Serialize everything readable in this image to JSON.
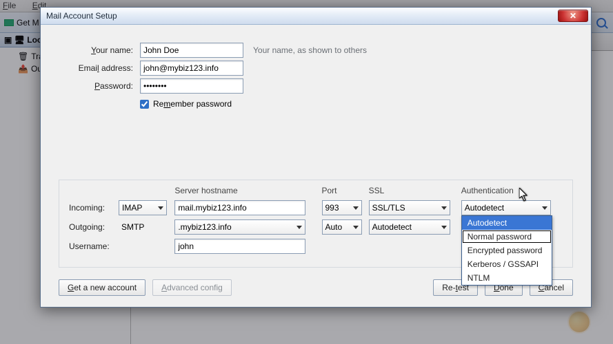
{
  "app": {
    "menubar": {
      "file": "File",
      "edit": "Edit"
    },
    "toolbar": {
      "get_messages": "Get M"
    },
    "sidebar": {
      "header_prefix": "Loca",
      "items": [
        {
          "label": "Tra"
        },
        {
          "label": "Ou"
        }
      ]
    }
  },
  "dialog": {
    "title": "Mail Account Setup",
    "close_glyph": "✕",
    "labels": {
      "your_name": "Your name:",
      "your_name_u": "Y",
      "email": "Email address:",
      "email_u": "l",
      "password": "Password:",
      "password_u": "P",
      "remember": "Remember password",
      "remember_u": "m",
      "hint_name": "Your name, as shown to others",
      "incoming": "Incoming:",
      "outgoing": "Outgoing:",
      "username": "Username:"
    },
    "values": {
      "name": "John Doe",
      "email": "john@mybiz123.info",
      "password": "••••••••",
      "remember_checked": true,
      "incoming_proto": "IMAP",
      "outgoing_proto": "SMTP",
      "incoming_host": "mail.mybiz123.info",
      "outgoing_host": ".mybiz123.info",
      "incoming_port": "993",
      "outgoing_port": "Auto",
      "incoming_ssl": "SSL/TLS",
      "outgoing_ssl": "Autodetect",
      "incoming_auth": "Autodetect",
      "username": "john"
    },
    "headers": {
      "server": "Server hostname",
      "port": "Port",
      "ssl": "SSL",
      "auth": "Authentication"
    },
    "auth_options": [
      "Autodetect",
      "Normal password",
      "Encrypted password",
      "Kerberos / GSSAPI",
      "NTLM"
    ],
    "auth_highlight_index": 0,
    "auth_selected_index": 1,
    "buttons": {
      "new_account": "Get a new account",
      "new_account_u": "G",
      "advanced": "Advanced config",
      "advanced_u": "A",
      "retest": "Re-test",
      "retest_u": "t",
      "done": "Done",
      "done_u": "D",
      "cancel": "Cancel",
      "cancel_u": "C"
    }
  }
}
